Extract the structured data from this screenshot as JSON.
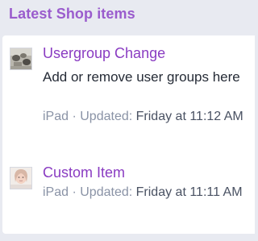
{
  "block": {
    "title": "Latest Shop items"
  },
  "items": [
    {
      "title": "Usergroup Change",
      "description": "Add or remove user groups here",
      "author": "iPad",
      "separator": " · ",
      "updated_label": "Updated: ",
      "updated_time": "Friday at 11:12 AM",
      "thumbnail": "usergroup-photo-thumbnail"
    },
    {
      "title": "Custom Item",
      "author": "iPad",
      "separator": " · ",
      "updated_label": "Updated: ",
      "updated_time": "Friday at 11:11 AM",
      "thumbnail": "portrait-photo-thumbnail"
    }
  ],
  "colors": {
    "header": "#9a5ccd",
    "link": "#8a3cc2",
    "meta": "#8a93a6",
    "background": "#e8eaf1"
  }
}
